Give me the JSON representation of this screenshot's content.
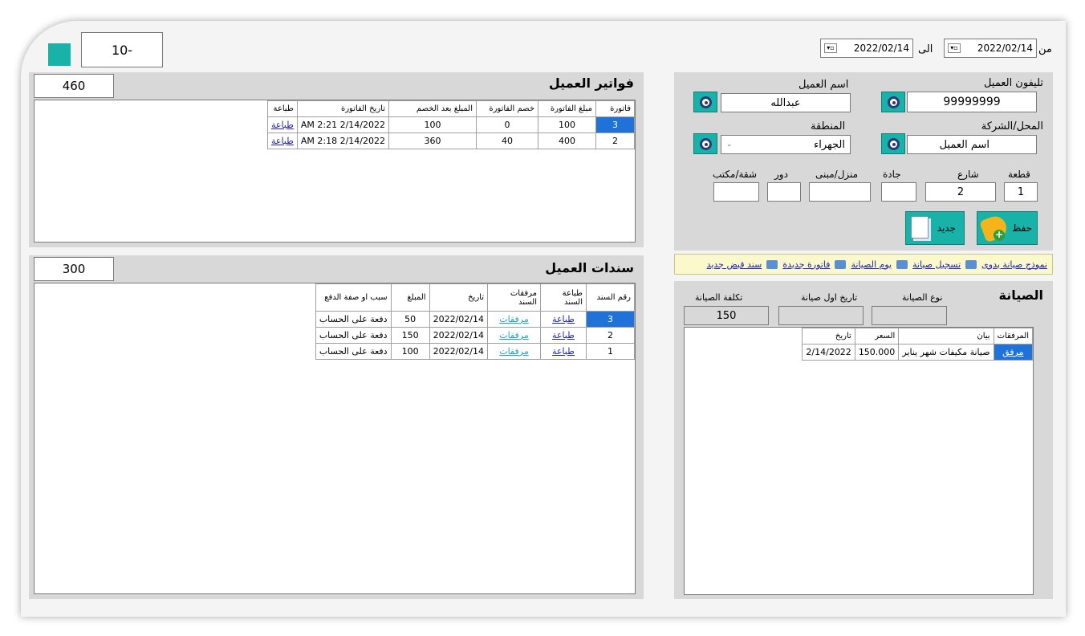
{
  "top": {
    "counter_value": "-10",
    "from_label": "من",
    "to_label": "الى",
    "date_from": "2022/02/14",
    "date_to": "2022/02/14"
  },
  "customer": {
    "phone_label": "تليفون العميل",
    "phone_value": "99999999",
    "name_label": "اسم العميل",
    "name_value": "عبدالله",
    "shop_label": "المحل/الشركة",
    "shop_value": "اسم العميل",
    "region_label": "المنطقة",
    "region_value": "الجهراء",
    "block_label": "قطعة",
    "block_value": "1",
    "street_label": "شارع",
    "street_value": "2",
    "avenue_label": "جادة",
    "avenue_value": "",
    "house_label": "منزل/مبنى",
    "house_value": "",
    "floor_label": "دور",
    "floor_value": "",
    "apt_label": "شقة/مكتب",
    "apt_value": "",
    "save_label": "حفظ",
    "new_label": "جديد"
  },
  "links": [
    "نموذج صيانة يدوى",
    "تسجيل صيانة",
    "يوم الصيانة",
    "فاتورة جديدة",
    "سند قبض جديد"
  ],
  "maintenance": {
    "title": "الصيانة",
    "type_label": "نوع الصيانة",
    "first_date_label": "تاريخ اول صيانة",
    "cost_label": "تكلفة الصيانة",
    "type_value": "",
    "first_date_value": "",
    "cost_value": "150",
    "headers": [
      "المرفقات",
      "بيان",
      "السعر",
      "تاريخ"
    ],
    "rows": [
      [
        "مرفق",
        "صيانة مكيفات شهر يناير",
        "150.000",
        "2/14/2022"
      ]
    ]
  },
  "invoices": {
    "title": "فواتير العميل",
    "total": "460",
    "headers": [
      "فاتورة",
      "مبلغ الفاتورة",
      "خصم الفاتورة",
      "المبلغ بعد الخصم",
      "تاريخ الفاتورة",
      "طباعة"
    ],
    "rows": [
      [
        "3",
        "100",
        "0",
        "100",
        "2/14/2022 2:21 AM",
        "طباعة"
      ],
      [
        "2",
        "400",
        "40",
        "360",
        "2/14/2022 2:18 AM",
        "طباعة"
      ]
    ]
  },
  "receipts": {
    "title": "سندات العميل",
    "total": "300",
    "headers": [
      "رقم السند",
      "طباعة السند",
      "مرفقات السند",
      "تاريخ",
      "المبلغ",
      "سبب او صفة الدفع"
    ],
    "rows": [
      [
        "3",
        "طباعة",
        "مرفقات",
        "2022/02/14",
        "50",
        "دفعة على الحساب"
      ],
      [
        "2",
        "طباعة",
        "مرفقات",
        "2022/02/14",
        "150",
        "دفعة على الحساب"
      ],
      [
        "1",
        "طباعة",
        "مرفقات",
        "2022/02/14",
        "100",
        "دفعة على الحساب"
      ]
    ]
  },
  "colors": {
    "accent": "#19b2a8",
    "selection": "#1e72d8",
    "link": "#1b20c8"
  }
}
